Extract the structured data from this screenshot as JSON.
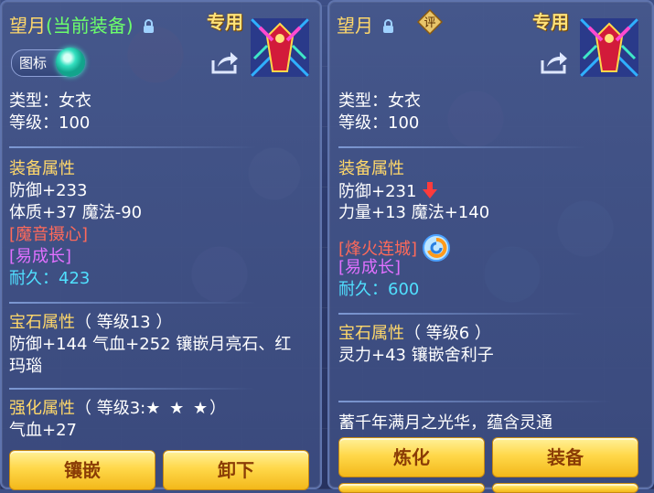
{
  "left": {
    "name": "望月",
    "equipped_tag": "(当前装备)",
    "exclusive": "专用",
    "toggle_label": "图标",
    "type_line": "类型：女衣",
    "level_line": "等级：100",
    "attr_header": "装备属性",
    "attr_line1": "防御+233",
    "attr_line2": "体质+37 魔法-90",
    "special1": "[魔音摄心]",
    "special2": "[易成长]",
    "durability": "耐久：423",
    "gem_header": "宝石属性",
    "gem_level": "（ 等级13 ）",
    "gem_line1": "防御+144 气血+252 镶嵌月亮石、红",
    "gem_line2": "玛瑙",
    "forge_header": "强化属性",
    "forge_level": "（ 等级3:",
    "forge_stars": "★ ★ ★",
    "forge_close": "）",
    "forge_line1": "气血+27",
    "btn_inlay": "镶嵌",
    "btn_unequip": "卸下"
  },
  "right": {
    "name": "望月",
    "rating_badge": "评",
    "exclusive": "专用",
    "type_line": "类型：女衣",
    "level_line": "等级：100",
    "attr_header": "装备属性",
    "attr_line1": "防御+231",
    "attr_line2": "力量+13 魔法+140",
    "special1": "[烽火连城]",
    "special2": "[易成长]",
    "durability": "耐久：600",
    "gem_header": "宝石属性",
    "gem_level": "（ 等级6 ）",
    "gem_line1": "灵力+43 镶嵌舍利子",
    "flavor": "蓄千年满月之光华，蕴含灵通",
    "btn_refine": "炼化",
    "btn_equip": "装备"
  },
  "colors": {
    "title": "#ffd86a",
    "equipped": "#6cff6c",
    "special": "#ff6a5a",
    "growth": "#e070ff",
    "durability": "#50e0ff",
    "button": "#ffd84a"
  },
  "icons": [
    "lock-icon",
    "share-icon",
    "armor-item-icon",
    "rating-badge-icon",
    "stat-decrease-icon",
    "skill-swirl-icon"
  ]
}
